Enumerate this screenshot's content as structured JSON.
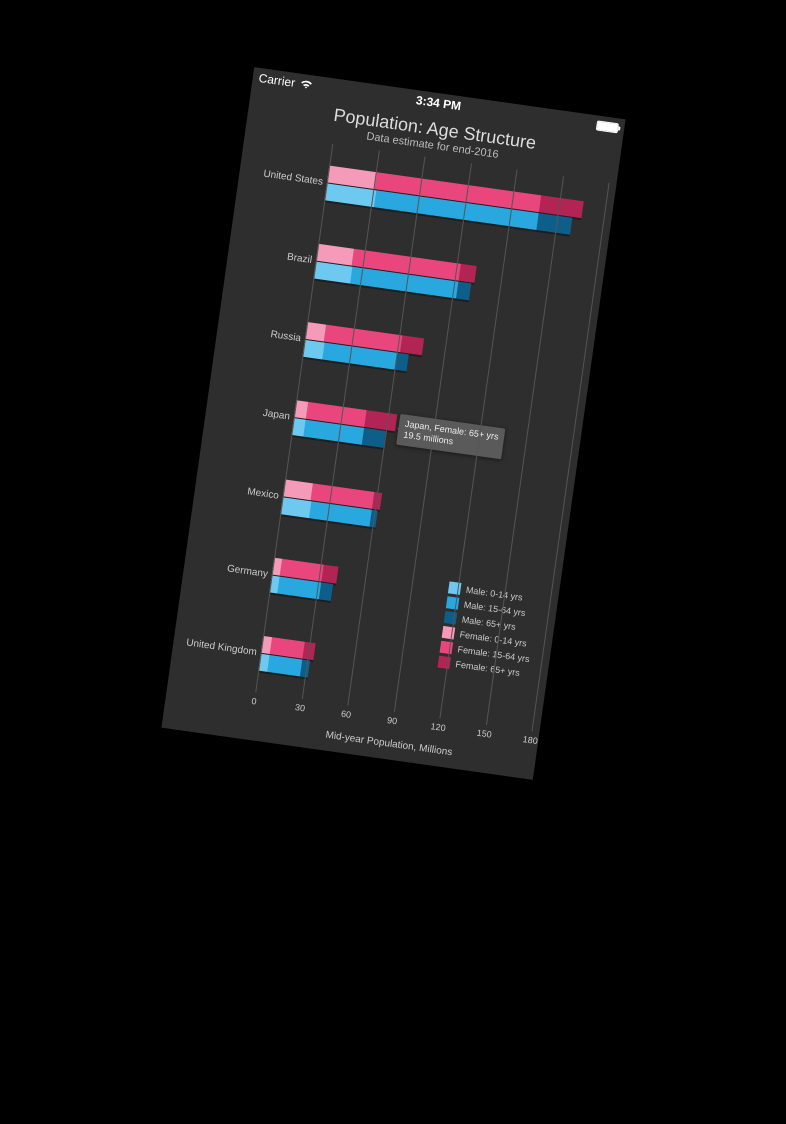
{
  "status_bar": {
    "carrier": "Carrier",
    "time": "3:34 PM"
  },
  "chart": {
    "title": "Population: Age Structure",
    "subtitle": "Data estimate for end-2016",
    "xlabel": "Mid-year Population, Millions"
  },
  "tooltip": {
    "line1": "Japan, Female: 65+ yrs",
    "line2": "19.5 millions"
  },
  "legend": {
    "m0": "Male: 0-14 yrs",
    "m1": "Male: 15-64 yrs",
    "m2": "Male: 65+ yrs",
    "f0": "Female: 0-14 yrs",
    "f1": "Female: 15-64 yrs",
    "f2": "Female: 65+ yrs"
  },
  "xticks": {
    "t0": "0",
    "t1": "30",
    "t2": "60",
    "t3": "90",
    "t4": "120",
    "t5": "150",
    "t6": "180"
  },
  "categories": {
    "c0": "United States",
    "c1": "Brazil",
    "c2": "Russia",
    "c3": "Japan",
    "c4": "Mexico",
    "c5": "Germany",
    "c6": "United Kingdom"
  },
  "colors": {
    "m0": "#6EC9F0",
    "m1": "#29A7DF",
    "m2": "#0E5E8A",
    "f0": "#F59AB9",
    "f1": "#E9467E",
    "f2": "#B22453",
    "tooltip_bg": "#5a5a5a",
    "grid": "#555",
    "bg": "#2e2e2e"
  },
  "chart_data": {
    "type": "bar",
    "orientation": "horizontal",
    "stacked": true,
    "title": "Population: Age Structure",
    "subtitle": "Data estimate for end-2016",
    "xlabel": "Mid-year Population, Millions",
    "ylabel": "",
    "xlim": [
      0,
      180
    ],
    "xticks": [
      0,
      30,
      60,
      90,
      120,
      150,
      180
    ],
    "categories": [
      "United States",
      "Brazil",
      "Russia",
      "Japan",
      "Mexico",
      "Germany",
      "United Kingdom"
    ],
    "series": [
      {
        "name": "Female: 0-14 yrs",
        "gender": "female",
        "color": "#F59AB9",
        "values": [
          31,
          23,
          12,
          8,
          18,
          5,
          6
        ]
      },
      {
        "name": "Female: 15-64 yrs",
        "gender": "female",
        "color": "#E9467E",
        "values": [
          107,
          70,
          50,
          38,
          40,
          27,
          21
        ]
      },
      {
        "name": "Female: 65+ yrs",
        "gender": "female",
        "color": "#B22453",
        "values": [
          28,
          10,
          14,
          19.5,
          5,
          10,
          7
        ]
      },
      {
        "name": "Male: 0-14 yrs",
        "gender": "male",
        "color": "#6EC9F0",
        "values": [
          32,
          24,
          13,
          8,
          19,
          5,
          6
        ]
      },
      {
        "name": "Male: 15-64 yrs",
        "gender": "male",
        "color": "#29A7DF",
        "values": [
          106,
          69,
          47,
          38,
          39,
          27,
          21
        ]
      },
      {
        "name": "Male: 65+ yrs",
        "gender": "male",
        "color": "#0E5E8A",
        "values": [
          22,
          8,
          8,
          14,
          4,
          8,
          5
        ]
      }
    ],
    "highlight": {
      "category": "Japan",
      "series": "Female: 65+ yrs",
      "value": 19.5
    },
    "legend_position": "bottom-right"
  }
}
